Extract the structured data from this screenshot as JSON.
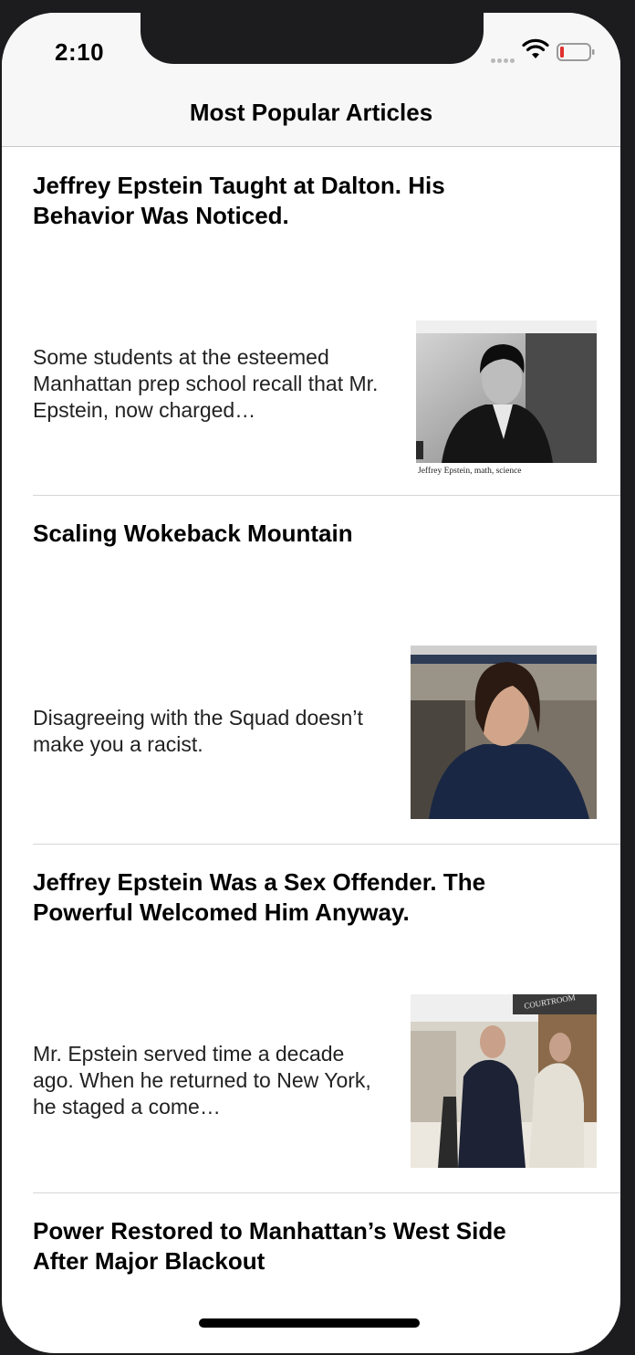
{
  "status_bar": {
    "time": "2:10"
  },
  "nav": {
    "title": "Most Popular Articles"
  },
  "articles": [
    {
      "title": "Jeffrey Epstein Taught at Dalton. His Behavior Was Noticed.",
      "abstract": "Some students at the esteemed Manhattan prep school recall that Mr. Epstein, now charged…",
      "thumbnail_caption": "Jeffrey Epstein, math, science"
    },
    {
      "title": "Scaling Wokeback Mountain",
      "abstract": "Disagreeing with the Squad doesn’t make you a racist."
    },
    {
      "title": "Jeffrey Epstein Was a Sex Offender. The Powerful Welcomed Him Anyway.",
      "abstract": "Mr. Epstein served time a decade ago. When he returned to New York, he staged a come…",
      "thumbnail_sign": "COURTROOM"
    },
    {
      "title": "Power Restored to Manhattan’s West Side After Major Blackout"
    }
  ],
  "colors": {
    "nav_background": "#f7f7f7",
    "separator": "#d6d6d8",
    "battery_low": "#e0312f"
  }
}
